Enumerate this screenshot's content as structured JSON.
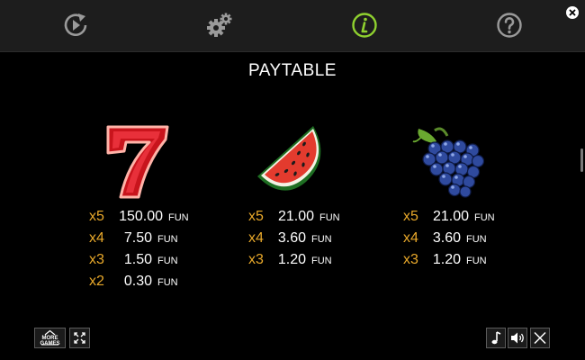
{
  "toolbar": {
    "icons": [
      "autoplay-icon",
      "settings-gears-icon",
      "info-icon",
      "help-icon"
    ],
    "active_color": "#8fd12f",
    "icon_color": "#9a9a9a"
  },
  "title": "PAYTABLE",
  "symbols": [
    {
      "icon": "seven-icon",
      "pays": [
        {
          "mult": "x5",
          "amount": "150.00",
          "unit": "FUN"
        },
        {
          "mult": "x4",
          "amount": "7.50",
          "unit": "FUN"
        },
        {
          "mult": "x3",
          "amount": "1.50",
          "unit": "FUN"
        },
        {
          "mult": "x2",
          "amount": "0.30",
          "unit": "FUN"
        }
      ]
    },
    {
      "icon": "watermelon-icon",
      "pays": [
        {
          "mult": "x5",
          "amount": "21.00",
          "unit": "FUN"
        },
        {
          "mult": "x4",
          "amount": "3.60",
          "unit": "FUN"
        },
        {
          "mult": "x3",
          "amount": "1.20",
          "unit": "FUN"
        }
      ]
    },
    {
      "icon": "grapes-icon",
      "pays": [
        {
          "mult": "x5",
          "amount": "21.00",
          "unit": "FUN"
        },
        {
          "mult": "x4",
          "amount": "3.60",
          "unit": "FUN"
        },
        {
          "mult": "x3",
          "amount": "1.20",
          "unit": "FUN"
        }
      ]
    }
  ],
  "bottom": {
    "more_games": "MORE GAMES"
  },
  "colors": {
    "multiplier": "#e8a82a",
    "background": "#000000",
    "topbar": "#1d1d1d"
  }
}
